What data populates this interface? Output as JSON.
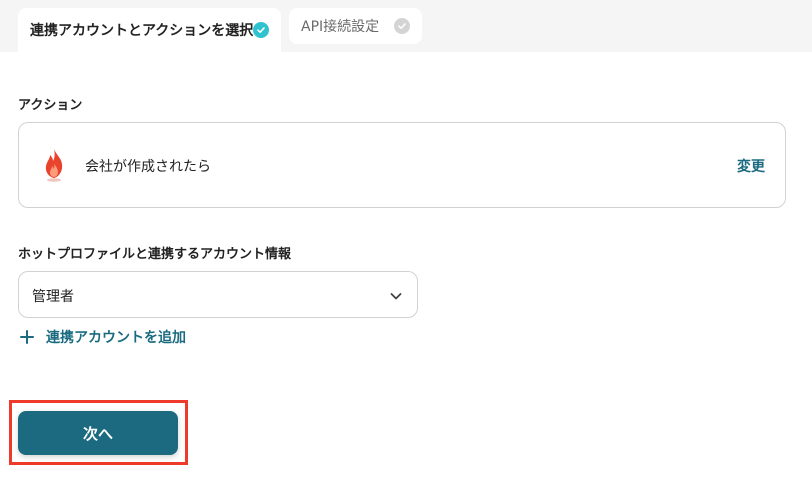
{
  "tabs": [
    {
      "label": "連携アカウントとアクションを選択",
      "state": "active"
    },
    {
      "label": "API接続設定",
      "state": "inactive"
    }
  ],
  "action_section": {
    "title": "アクション",
    "action_text": "会社が作成されたら",
    "change_label": "変更",
    "app_icon": "hubspot-flame-icon"
  },
  "account_section": {
    "title": "ホットプロファイルと連携するアカウント情報",
    "selected_account": "管理者",
    "add_account_label": "連携アカウントを追加"
  },
  "footer": {
    "next_label": "次へ"
  },
  "colors": {
    "accent": "#1b6a80",
    "check_active": "#2ec3cf",
    "highlight": "#ee3a2a"
  }
}
